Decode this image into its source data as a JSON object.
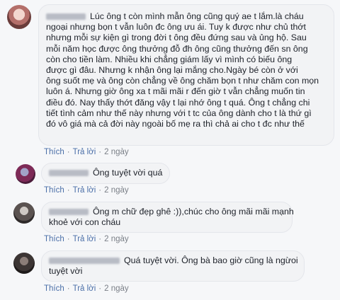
{
  "actions": {
    "like": "Thích",
    "reply": "Trả lời",
    "sep": "·"
  },
  "comments": [
    {
      "lines": [
        "Lúc ông t còn mình mẫn ông cũng quý ae t lắm.là cháu",
        "ngoại nhưng bọn t vẫn luôn đc ông ưu ái. Tuy k được như chủ thớt",
        "nhưng mỗi sự kiện gì trong đời t ông đều đứng sau và ủng hộ. Sau",
        "mỗi năm học được ông thưởng đỗ đh ông cũng thưởng đến sn ông",
        "còn cho tiền làm. Nhiều khi chẳng giám lấy vì mình có biếu ông",
        "được gì đâu. Nhưng k nhận ông lại mắng cho.Ngày bé còn ở với",
        "ông suốt mẹ và ông còn chẳng về ông chăm bọn t như chăm con mọn",
        "luôn á. Nhưng giờ ông xa t mãi mãi r đến giờ t vẫn chẳng muốn tin",
        "điều đó. Nay thấy thớt đăng vậy t lại nhớ ông t quá. Ông t chẳng chi",
        "tiết tình cảm như thế này nhưng với t tc của ông dành cho t là thứ gì",
        "đó vô giá mà cả đời này ngoài bố mẹ ra thì chả ai cho t đc như thế"
      ],
      "time": "2 ngày"
    },
    {
      "lines": [
        "Ông tuyệt vời quá"
      ],
      "time": "2 ngày"
    },
    {
      "lines": [
        "Ông m chữ đẹp ghê :)),chúc cho ông mãi mãi mạnh",
        "khoẻ với con cháu"
      ],
      "time": "2 ngày"
    },
    {
      "lines": [
        "Quá tuyệt vời. Ông bà bao giờ cũng là ngừoi",
        "tuyệt vời"
      ],
      "time": "2 ngày"
    }
  ]
}
